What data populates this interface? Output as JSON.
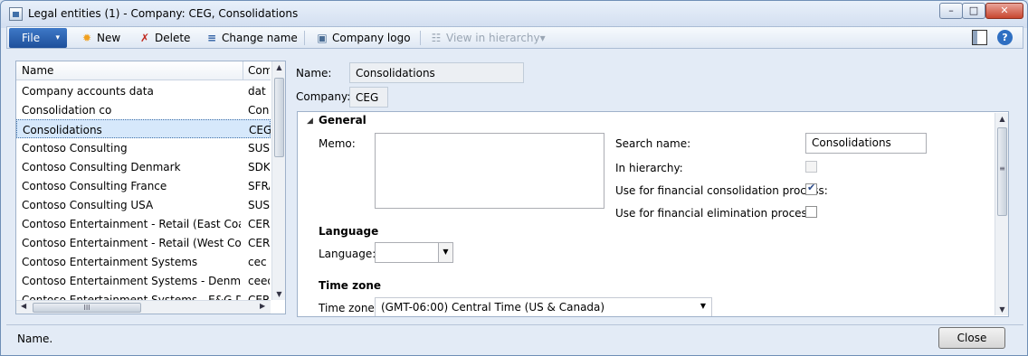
{
  "window": {
    "title": "Legal entities (1) - Company: CEG, Consolidations",
    "min_glyph": "–",
    "max_glyph": "□",
    "close_glyph": "✕"
  },
  "toolbar": {
    "file_label": "File",
    "file_caret": "▾",
    "new_label": "New",
    "delete_label": "Delete",
    "change_name_label": "Change name",
    "company_logo_label": "Company logo",
    "view_hierarchy_label": "View in hierarchy",
    "view_hierarchy_caret": "▾",
    "new_icon": "✹",
    "delete_icon": "✗",
    "change_name_icon": "≡",
    "company_logo_icon": "▣",
    "view_hierarchy_icon": "☷",
    "icon_colors": {
      "new": "#f0a020",
      "delete": "#c0281e",
      "change_name": "#2e5fa3",
      "company_logo": "#4a6d95",
      "view_hierarchy": "#9aa6b4"
    },
    "layout_icon": "▨",
    "help_icon": "?"
  },
  "list": {
    "columns": [
      "Name",
      "Company"
    ],
    "rows": [
      {
        "name": "Company accounts data",
        "company": "dat"
      },
      {
        "name": "Consolidation co",
        "company": "Con"
      },
      {
        "name": "Consolidations",
        "company": "CEG"
      },
      {
        "name": "Contoso Consulting",
        "company": "SUSA"
      },
      {
        "name": "Contoso Consulting Denmark",
        "company": "SDKA"
      },
      {
        "name": "Contoso Consulting France",
        "company": "SFRA"
      },
      {
        "name": "Contoso Consulting USA",
        "company": "SUSE"
      },
      {
        "name": "Contoso Entertainment - Retail (East Coast)",
        "company": "CERE"
      },
      {
        "name": "Contoso Entertainment - Retail (West Coast)",
        "company": "CERW"
      },
      {
        "name": "Contoso Entertainment Systems",
        "company": "cec"
      },
      {
        "name": "Contoso Entertainment Systems - Denmark",
        "company": "ceed"
      },
      {
        "name": "Contoso Entertainment Systems - E&G Divi",
        "company": "CERE"
      }
    ],
    "selected_index": 2,
    "scroll_up": "▲",
    "scroll_down": "▼",
    "scroll_left": "◀",
    "scroll_right": "▶",
    "hthumb_grip": "III"
  },
  "header_fields": {
    "name_label": "Name:",
    "name_value": "Consolidations",
    "company_label": "Company:",
    "company_value": "CEG"
  },
  "general": {
    "title": "General",
    "memo_label": "Memo:",
    "memo_value": "",
    "search_name_label": "Search name:",
    "search_name_value": "Consolidations",
    "in_hierarchy_label": "In hierarchy:",
    "in_hierarchy_checked": false,
    "consolidation_label": "Use for financial consolidation process:",
    "consolidation_checked": true,
    "elimination_label": "Use for financial elimination process:",
    "elimination_checked": false
  },
  "language": {
    "title": "Language",
    "label": "Language:",
    "value": "",
    "caret": "▼"
  },
  "timezone": {
    "title": "Time zone",
    "label": "Time zone:",
    "value": "(GMT-06:00) Central Time (US & Canada)",
    "caret": "▼"
  },
  "section_toggle": "◢",
  "status": {
    "text": "Name.",
    "close_label": "Close"
  }
}
